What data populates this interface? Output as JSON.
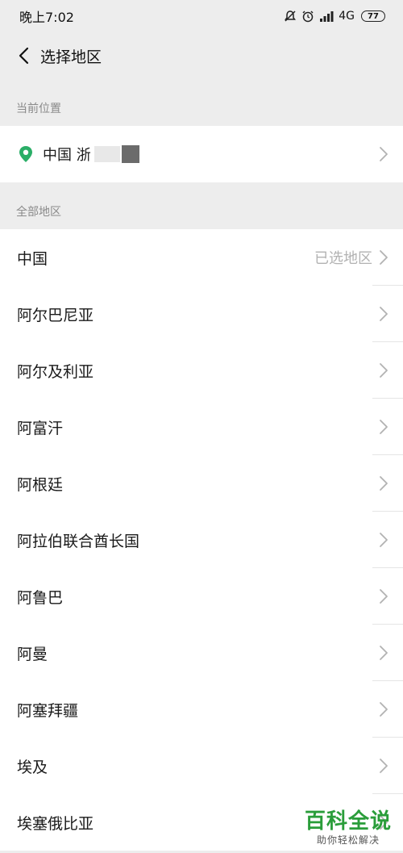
{
  "status_bar": {
    "time": "晚上7:02",
    "network": "4G",
    "battery": "77"
  },
  "nav": {
    "title": "选择地区"
  },
  "current_location": {
    "header": "当前位置",
    "text": "中国 浙"
  },
  "all_regions": {
    "header": "全部地区",
    "items": [
      {
        "name": "中国",
        "tag": "已选地区"
      },
      {
        "name": "阿尔巴尼亚",
        "tag": ""
      },
      {
        "name": "阿尔及利亚",
        "tag": ""
      },
      {
        "name": "阿富汗",
        "tag": ""
      },
      {
        "name": "阿根廷",
        "tag": ""
      },
      {
        "name": "阿拉伯联合酋长国",
        "tag": ""
      },
      {
        "name": "阿鲁巴",
        "tag": ""
      },
      {
        "name": "阿曼",
        "tag": ""
      },
      {
        "name": "阿塞拜疆",
        "tag": ""
      },
      {
        "name": "埃及",
        "tag": ""
      },
      {
        "name": "埃塞俄比亚",
        "tag": ""
      }
    ]
  },
  "watermark": {
    "main": "百科全说",
    "sub": "助你轻松解决"
  },
  "colors": {
    "accent_green": "#2aae67",
    "background": "#ededed"
  }
}
